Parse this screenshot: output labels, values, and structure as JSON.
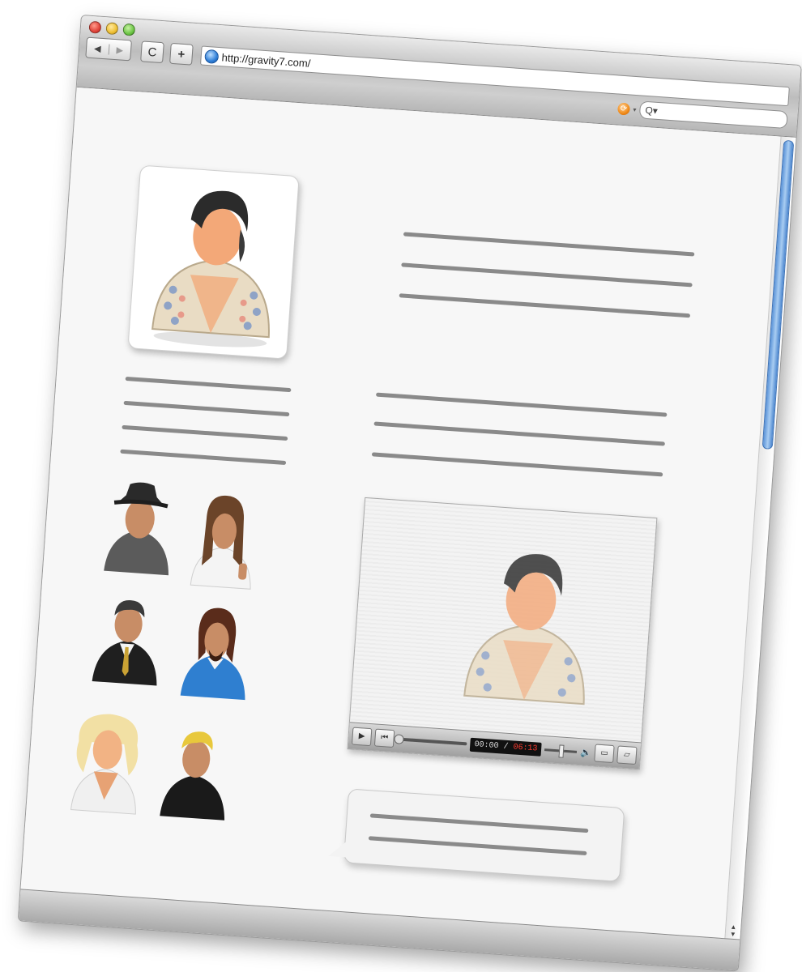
{
  "window": {
    "url": "http://gravity7.com/",
    "nav_back": "◀",
    "nav_forward": "▶",
    "reload": "C",
    "add_tab": "+",
    "search_placeholder": "Q▾",
    "rss_glyph": "⟳"
  },
  "player": {
    "current_time": "00:00",
    "separator": " / ",
    "duration": "06:13",
    "play_glyph": "▶",
    "skip_glyph": "⏮",
    "speaker_glyph": "🔈"
  },
  "colors": {
    "scroll_thumb": "#4b86cf",
    "duration_text": "#ff3b2f",
    "text_line": "#8a8a8a"
  },
  "icons": [
    "traffic-light-close",
    "traffic-light-minimize",
    "traffic-light-zoom",
    "globe-icon",
    "rss-icon",
    "search-icon"
  ],
  "avatars": [
    "elvis-avatar",
    "hat-man-avatar",
    "long-hair-woman-avatar",
    "businessman-avatar",
    "bearded-man-avatar",
    "blonde-woman-avatar",
    "blond-man-avatar"
  ]
}
